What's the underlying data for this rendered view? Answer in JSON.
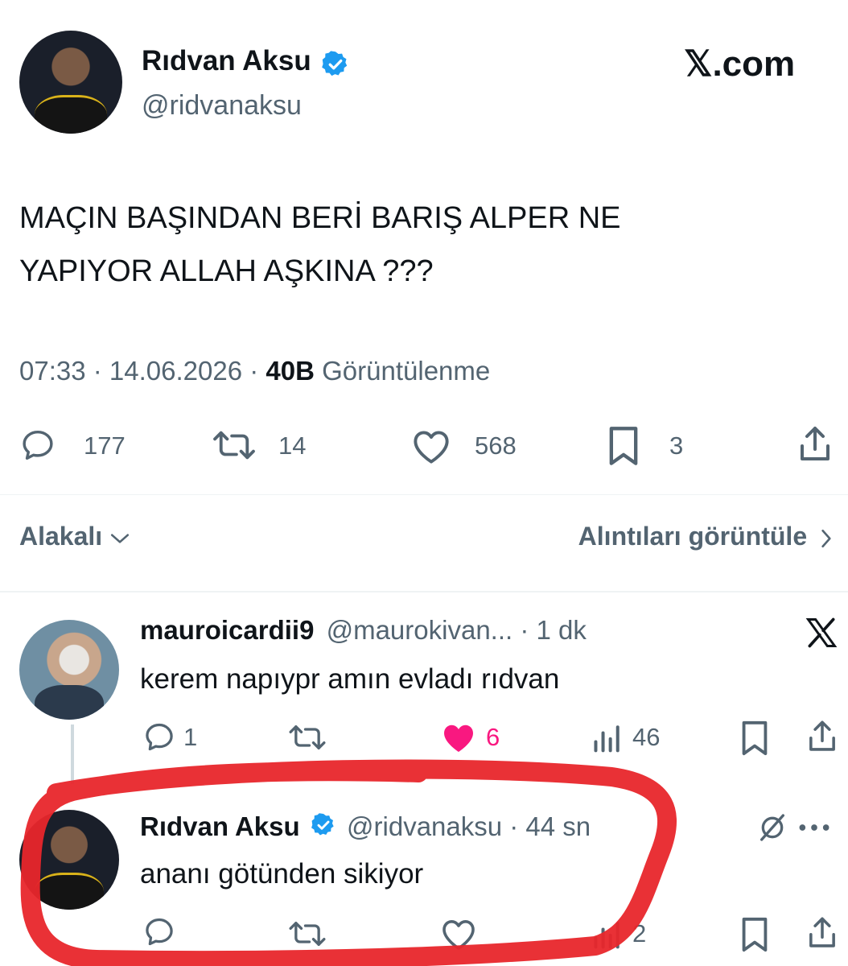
{
  "brand": {
    "label": "𝕏.com"
  },
  "main_tweet": {
    "author_name": "Rıdvan Aksu",
    "handle": "@ridvanaksu",
    "text_line1": "MAÇIN BAŞINDAN BERİ BARIŞ ALPER NE",
    "text_line2": "YAPIYOR ALLAH AŞKINA ???",
    "time_date": "07:33 · 14.06.2026 · ",
    "views_count": "40B",
    "views_label": " Görüntülenme",
    "stats": {
      "replies": "177",
      "reposts": "14",
      "likes": "568",
      "bookmarks": "3"
    }
  },
  "filter": {
    "relevance_label": "Alakalı",
    "quotes_label": "Alıntıları görüntüle"
  },
  "reply1": {
    "author_name": "mauroicardii9",
    "handle_time": "@maurokivan... · 1 dk",
    "text": "kerem napıypr amın evladı rıdvan",
    "stats": {
      "replies": "1",
      "likes": "6",
      "views": "46"
    }
  },
  "reply2": {
    "author_name": "Rıdvan Aksu",
    "handle_time": "@ridvanaksu · 44 sn",
    "text": "ananı götünden sikiyor",
    "stats": {
      "views": "2"
    }
  },
  "colors": {
    "verified_blue": "#1d9bf0",
    "like_pink": "#f91880",
    "text_gray": "#536471",
    "highlight_red": "#e8262b"
  }
}
